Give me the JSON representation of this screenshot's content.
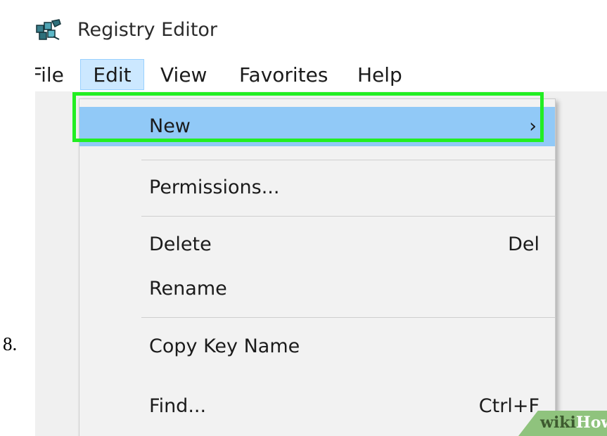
{
  "step_number": "8.",
  "window": {
    "title": "Registry Editor",
    "icon": "registry-editor-icon"
  },
  "menubar": {
    "items": [
      "File",
      "Edit",
      "View",
      "Favorites",
      "Help"
    ],
    "active": "Edit"
  },
  "edit_menu": {
    "items": [
      {
        "label": "New",
        "shortcut": "",
        "submenu": true,
        "highlighted": true
      },
      {
        "label": "Permissions...",
        "shortcut": ""
      },
      {
        "label": "Delete",
        "shortcut": "Del"
      },
      {
        "label": "Rename",
        "shortcut": ""
      },
      {
        "label": "Copy Key Name",
        "shortcut": ""
      },
      {
        "label": "Find...",
        "shortcut": "Ctrl+F"
      }
    ],
    "submenu_indicator": "›"
  },
  "annotation": {
    "highlight_color": "#22ee22",
    "highlight_target": "New"
  },
  "watermark": {
    "part1": "wiki",
    "part2": "How"
  },
  "colors": {
    "menu_highlight": "#91c9f7",
    "menubar_active": "#cce8ff",
    "menu_background": "#f2f2f2"
  }
}
